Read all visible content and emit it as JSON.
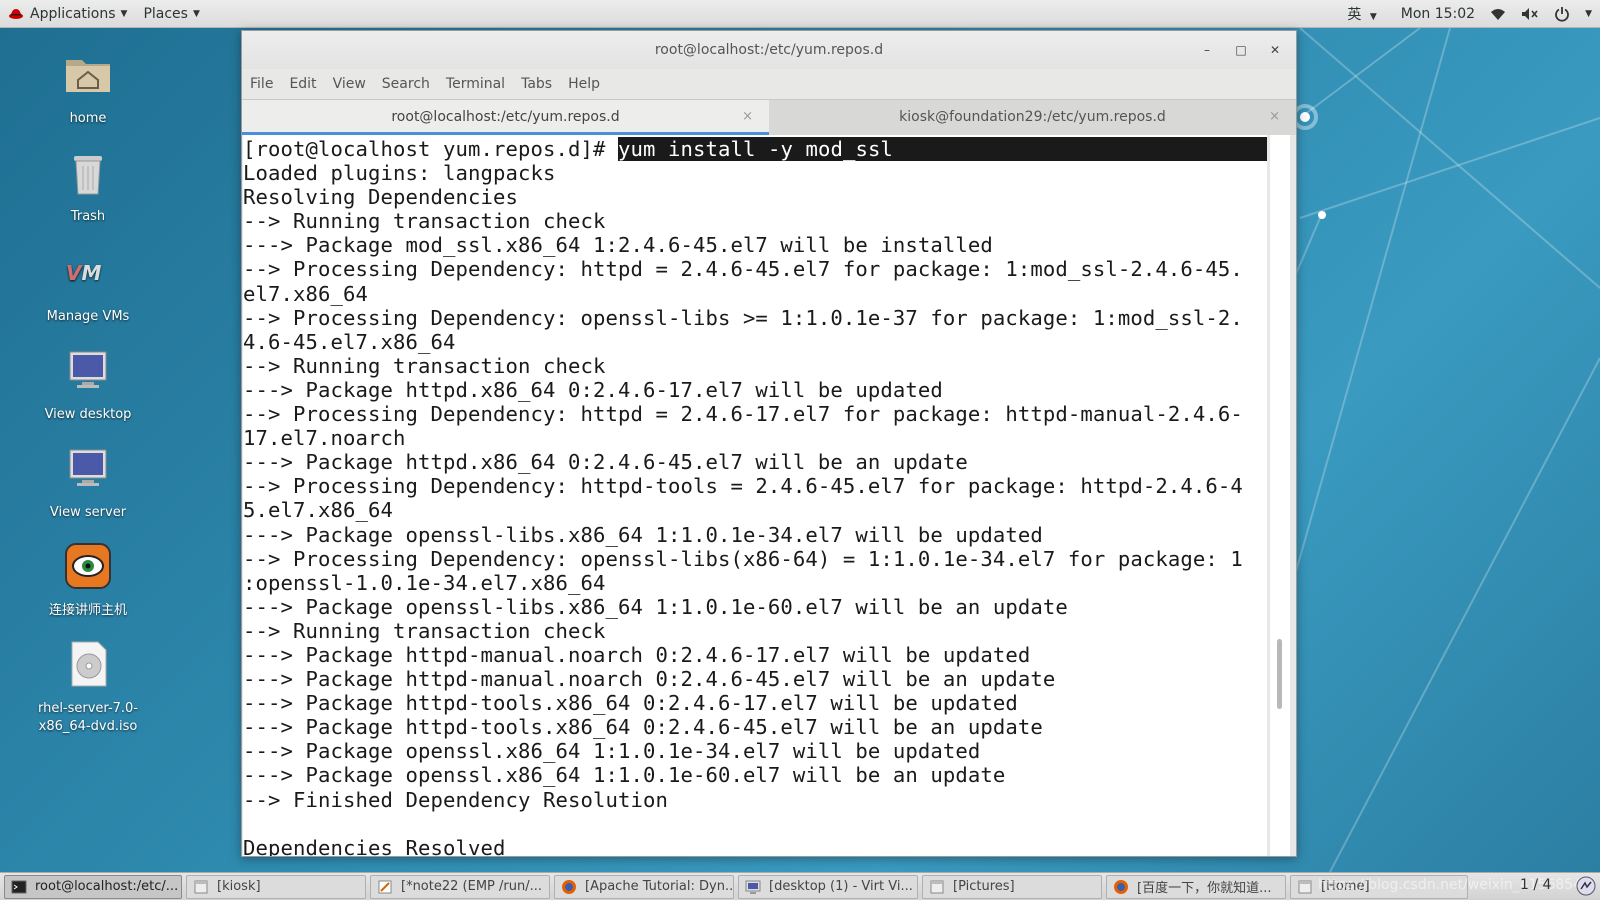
{
  "top_bar": {
    "applications_label": "Applications",
    "places_label": "Places",
    "input_method": "英",
    "clock": "Mon 15:02"
  },
  "desktop_icons": [
    {
      "label": "home",
      "icon": "home-folder-icon"
    },
    {
      "label": "Trash",
      "icon": "trash-icon"
    },
    {
      "label": "Manage VMs",
      "icon": "vm-manager-icon"
    },
    {
      "label": "View desktop",
      "icon": "monitor-icon"
    },
    {
      "label": "View server",
      "icon": "monitor-icon"
    },
    {
      "label": "连接讲师主机",
      "icon": "remote-viewer-icon"
    },
    {
      "label": "rhel-server-7.0-x86_64-dvd.iso",
      "icon": "disc-image-icon"
    }
  ],
  "window": {
    "title": "root@localhost:/etc/yum.repos.d",
    "minimize": "–",
    "maximize": "□",
    "close": "✕",
    "menu": [
      "File",
      "Edit",
      "View",
      "Search",
      "Terminal",
      "Tabs",
      "Help"
    ],
    "tabs": [
      {
        "label": "root@localhost:/etc/yum.repos.d",
        "close": "×"
      },
      {
        "label": "kiosk@foundation29:/etc/yum.repos.d",
        "close": "×"
      }
    ]
  },
  "terminal": {
    "prompt": "[root@localhost yum.repos.d]# ",
    "command": "yum install -y mod_ssl",
    "lines": [
      "Loaded plugins: langpacks",
      "Resolving Dependencies",
      "--> Running transaction check",
      "---> Package mod_ssl.x86_64 1:2.4.6-45.el7 will be installed",
      "--> Processing Dependency: httpd = 2.4.6-45.el7 for package: 1:mod_ssl-2.4.6-45.",
      "el7.x86_64",
      "--> Processing Dependency: openssl-libs >= 1:1.0.1e-37 for package: 1:mod_ssl-2.",
      "4.6-45.el7.x86_64",
      "--> Running transaction check",
      "---> Package httpd.x86_64 0:2.4.6-17.el7 will be updated",
      "--> Processing Dependency: httpd = 2.4.6-17.el7 for package: httpd-manual-2.4.6-",
      "17.el7.noarch",
      "---> Package httpd.x86_64 0:2.4.6-45.el7 will be an update",
      "--> Processing Dependency: httpd-tools = 2.4.6-45.el7 for package: httpd-2.4.6-4",
      "5.el7.x86_64",
      "---> Package openssl-libs.x86_64 1:1.0.1e-34.el7 will be updated",
      "--> Processing Dependency: openssl-libs(x86-64) = 1:1.0.1e-34.el7 for package: 1",
      ":openssl-1.0.1e-34.el7.x86_64",
      "---> Package openssl-libs.x86_64 1:1.0.1e-60.el7 will be an update",
      "--> Running transaction check",
      "---> Package httpd-manual.noarch 0:2.4.6-17.el7 will be updated",
      "---> Package httpd-manual.noarch 0:2.4.6-45.el7 will be an update",
      "---> Package httpd-tools.x86_64 0:2.4.6-17.el7 will be updated",
      "---> Package httpd-tools.x86_64 0:2.4.6-45.el7 will be an update",
      "---> Package openssl.x86_64 1:1.0.1e-34.el7 will be updated",
      "---> Package openssl.x86_64 1:1.0.1e-60.el7 will be an update",
      "--> Finished Dependency Resolution",
      "",
      "Dependencies Resolved"
    ]
  },
  "taskbar": {
    "items": [
      {
        "label": "root@localhost:/etc/...",
        "icon": "terminal-icon",
        "active": true
      },
      {
        "label": "[kiosk]",
        "icon": "window-icon",
        "active": false
      },
      {
        "label": "[*note22 (EMP /run/...",
        "icon": "text-editor-icon",
        "active": false
      },
      {
        "label": "[Apache Tutorial: Dyn...",
        "icon": "firefox-icon",
        "active": false
      },
      {
        "label": "[desktop (1) - Virt Vi...",
        "icon": "virt-viewer-icon",
        "active": false
      },
      {
        "label": "[Pictures]",
        "icon": "window-icon",
        "active": false
      },
      {
        "label": "[百度一下，你就知道...",
        "icon": "firefox-icon",
        "active": false
      },
      {
        "label": "[Home]",
        "icon": "window-icon",
        "active": false
      }
    ],
    "workspace": "1 / 4",
    "watermark": "https://blog.csdn.net/weixin_4156854"
  }
}
